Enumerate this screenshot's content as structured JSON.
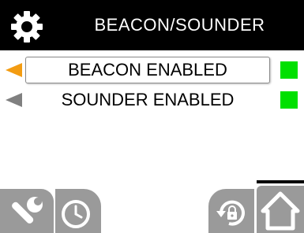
{
  "header": {
    "title": "BEACON/SOUNDER",
    "icon": "gear-icon"
  },
  "menu": {
    "items": [
      {
        "label": "BEACON ENABLED",
        "selected": true,
        "status": "enabled"
      },
      {
        "label": "SOUNDER ENABLED",
        "selected": false,
        "status": "enabled"
      }
    ]
  },
  "bottom_bar": {
    "buttons": [
      {
        "icon": "wrench-icon"
      },
      {
        "icon": "clock-icon"
      },
      {
        "icon": "lock-rotate-icon"
      },
      {
        "icon": "home-icon",
        "active": true
      }
    ]
  },
  "colors": {
    "header_bg": "#000000",
    "selected_arrow": "#f39c12",
    "idle_arrow": "#808080",
    "status_enabled": "#00e000",
    "button_bg": "#9a9a9a"
  }
}
